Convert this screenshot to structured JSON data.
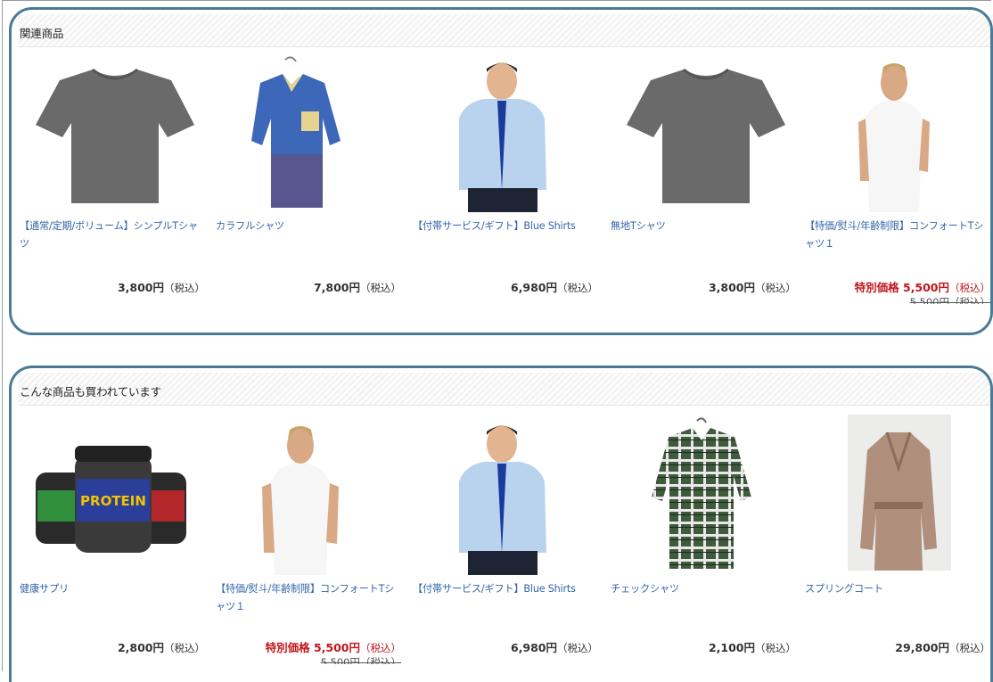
{
  "sections": [
    {
      "title": "関連商品",
      "items": [
        {
          "name": "【通常/定期/ボリューム】シンプルTシャツ",
          "price": "3,800円",
          "tax": "（税込）",
          "image": "gray-tshirt"
        },
        {
          "name": "カラフルシャツ",
          "price": "7,800円",
          "tax": "（税込）",
          "image": "colorful-shirt"
        },
        {
          "name": "【付帯サービス/ギフト】Blue Shirts",
          "price": "6,980円",
          "tax": "（税込）",
          "image": "man-blue-shirt"
        },
        {
          "name": "無地Tシャツ",
          "price": "3,800円",
          "tax": "（税込）",
          "image": "gray-tshirt"
        },
        {
          "name": "【特価/熨斗/年齢制限】コンフォートTシャツ１",
          "price": "特別価格 5,500円",
          "tax": "（税込）",
          "original": "5,500円（税込）",
          "image": "man-white-tshirt"
        }
      ]
    },
    {
      "title": "こんな商品も買われています",
      "items": [
        {
          "name": "健康サプリ",
          "price": "2,800円",
          "tax": "（税込）",
          "image": "protein-tubs"
        },
        {
          "name": "【特価/熨斗/年齢制限】コンフォートTシャツ１",
          "price": "特別価格 5,500円",
          "tax": "（税込）",
          "original": "5,500円（税込）",
          "image": "man-white-tshirt"
        },
        {
          "name": "【付帯サービス/ギフト】Blue Shirts",
          "price": "6,980円",
          "tax": "（税込）",
          "image": "man-blue-shirt"
        },
        {
          "name": "チェックシャツ",
          "price": "2,100円",
          "tax": "（税込）",
          "image": "check-shirt"
        },
        {
          "name": "スプリングコート",
          "price": "29,800円",
          "tax": "（税込）",
          "image": "beige-coat"
        }
      ]
    }
  ],
  "colors": {
    "link": "#3366aa",
    "sale": "#c0171b",
    "outline": "#4b7a97"
  }
}
